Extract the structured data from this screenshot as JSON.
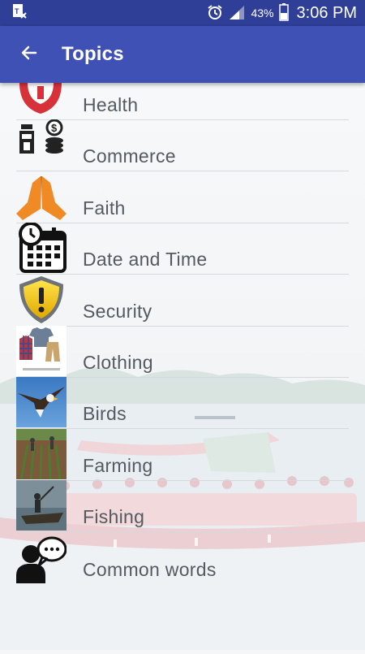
{
  "status_bar": {
    "battery": "43%",
    "time": "3:06 PM",
    "icons": [
      "notification-tx-icon",
      "alarm-icon",
      "signal-icon",
      "battery-icon"
    ]
  },
  "app_bar": {
    "title": "Topics",
    "back_icon": "arrow-left-icon"
  },
  "topics": [
    {
      "label": "Health",
      "icon": "health-icon"
    },
    {
      "label": "Commerce",
      "icon": "commerce-icon"
    },
    {
      "label": "Faith",
      "icon": "praying-hands-icon"
    },
    {
      "label": "Date and Time",
      "icon": "calendar-clock-icon"
    },
    {
      "label": "Security",
      "icon": "shield-icon"
    },
    {
      "label": "Clothing",
      "icon": "clothing-image"
    },
    {
      "label": "Birds",
      "icon": "bird-image"
    },
    {
      "label": "Farming",
      "icon": "farming-image"
    },
    {
      "label": "Fishing",
      "icon": "fishing-image"
    },
    {
      "label": "Common words",
      "icon": "speech-bubble-person-icon"
    }
  ],
  "colors": {
    "status_bar": "#2f3f98",
    "app_bar": "#3f51b5",
    "text": "#555a60",
    "divider": "#d5d9de"
  }
}
